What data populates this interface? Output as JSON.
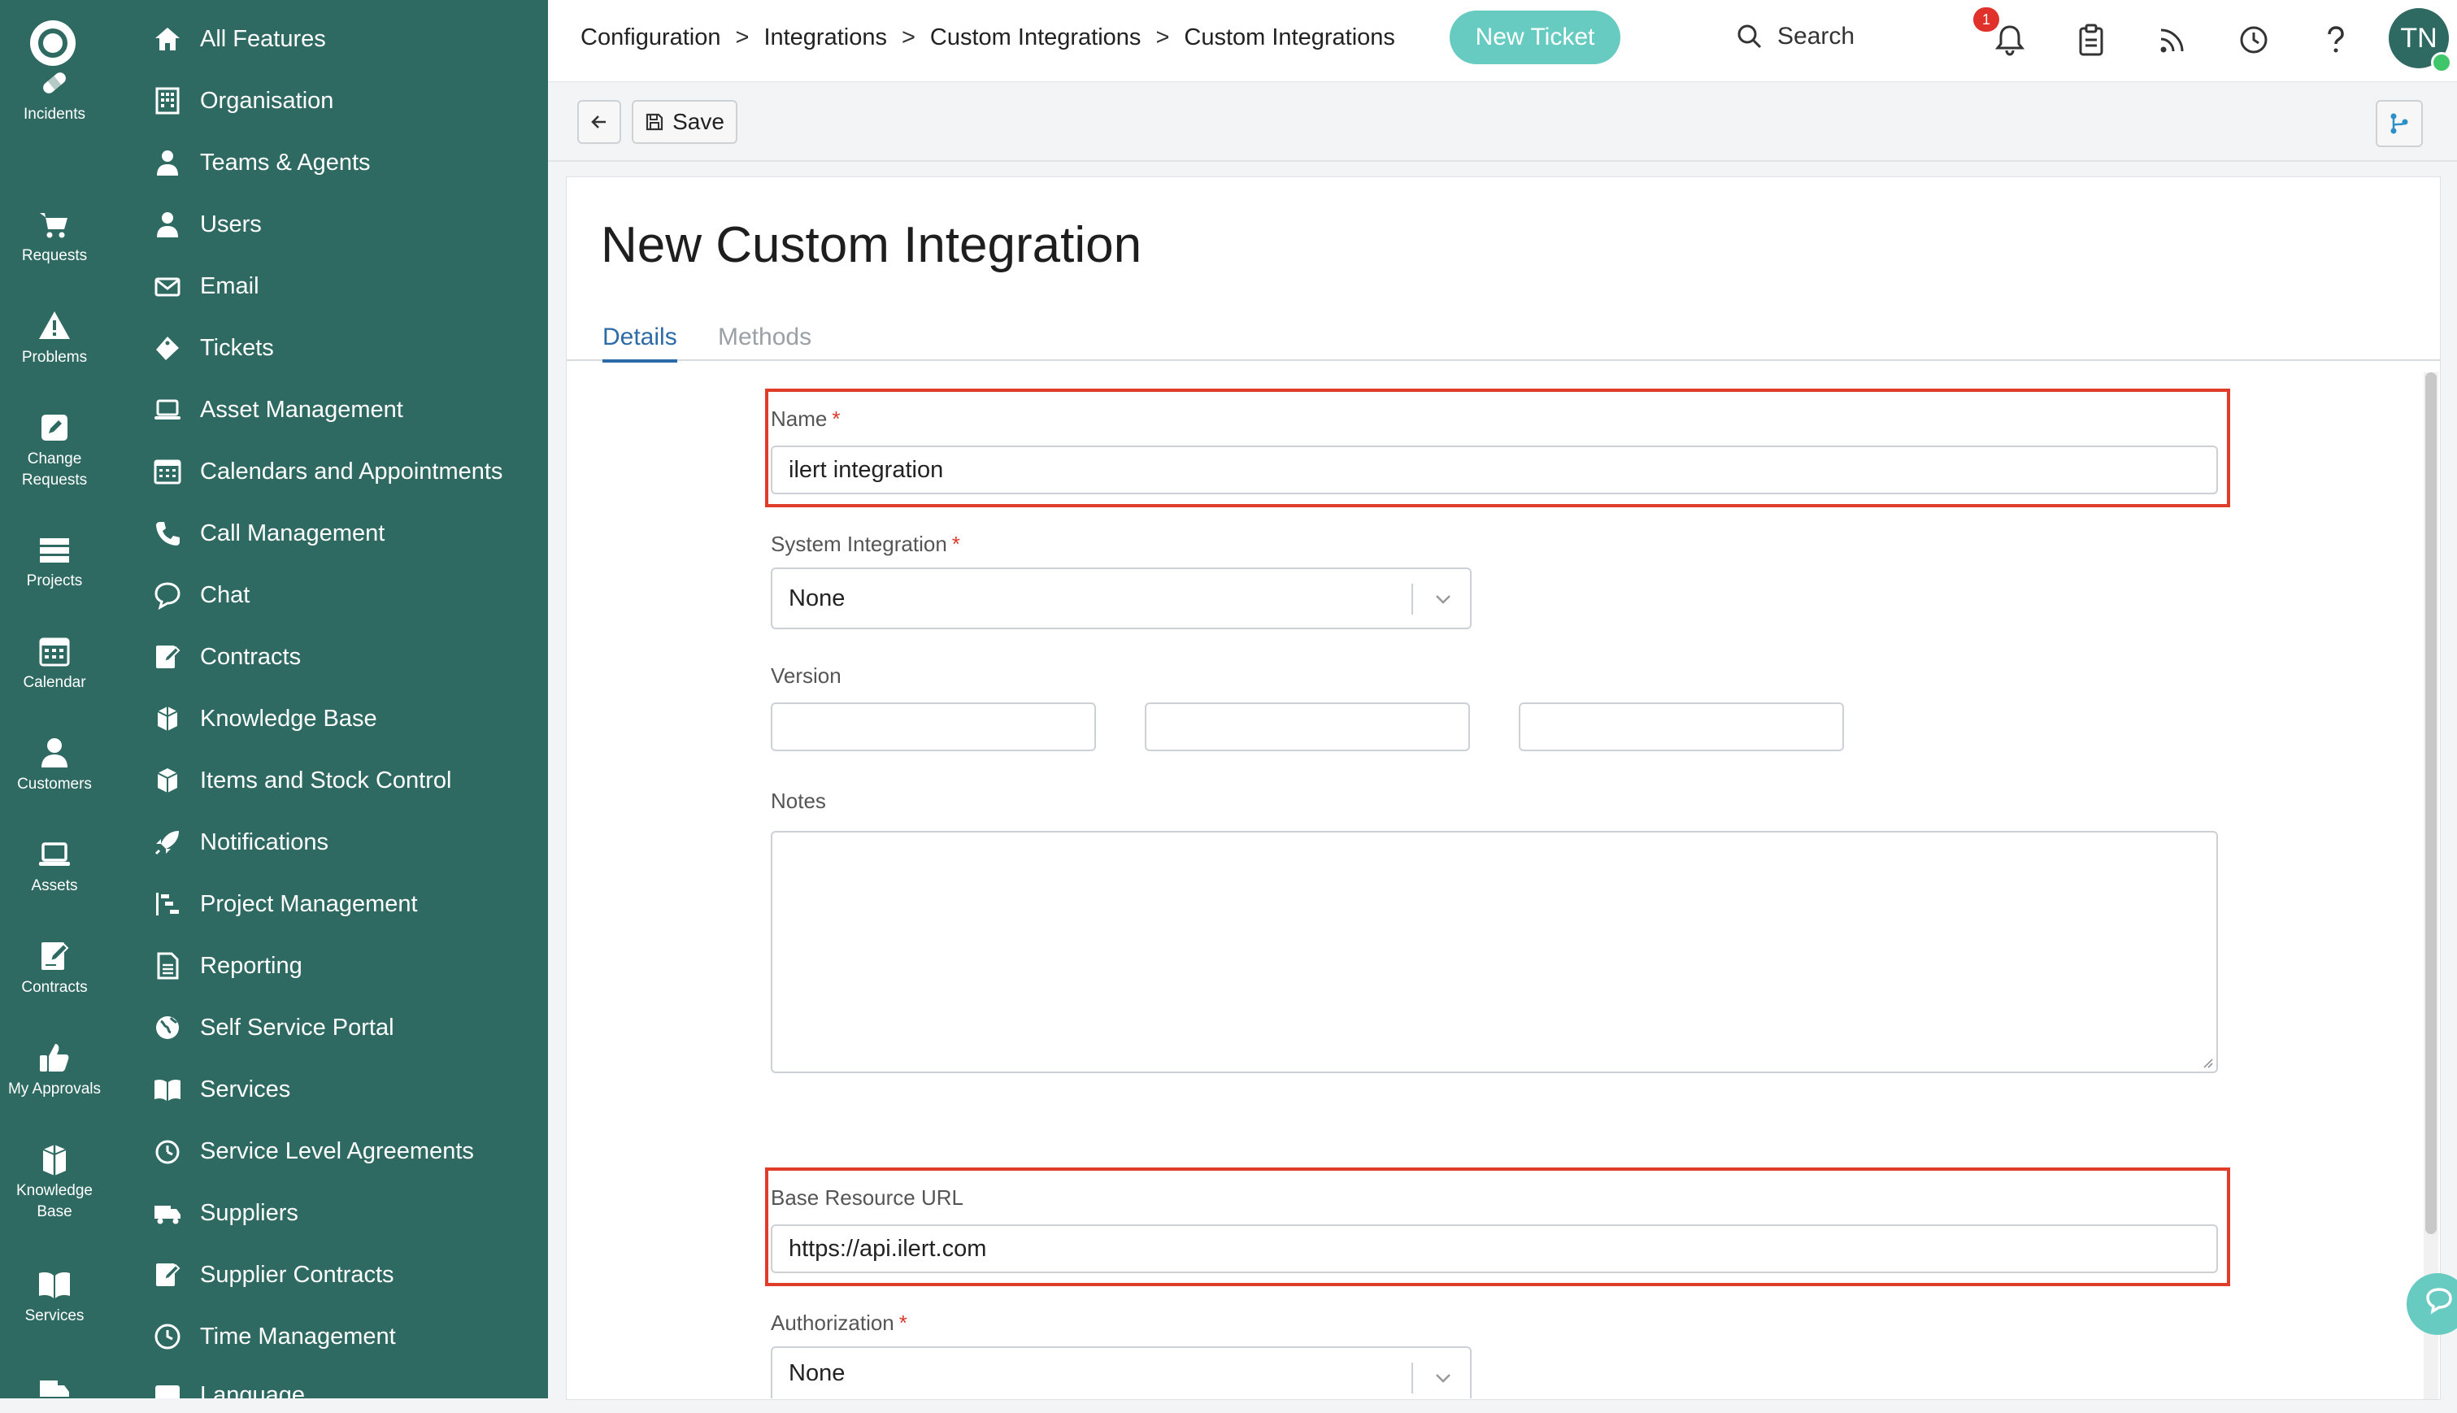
{
  "rail": {
    "items": [
      {
        "label": "Incidents",
        "icon": "bandage-icon"
      },
      {
        "label": "Requests",
        "icon": "cart-icon"
      },
      {
        "label": "Problems",
        "icon": "warning-icon"
      },
      {
        "label": "Change Requests",
        "line1": "Change",
        "line2": "Requests",
        "icon": "edit-icon"
      },
      {
        "label": "Projects",
        "icon": "projects-icon"
      },
      {
        "label": "Calendar",
        "icon": "calendar-icon"
      },
      {
        "label": "Customers",
        "icon": "person-icon"
      },
      {
        "label": "Assets",
        "icon": "laptop-icon"
      },
      {
        "label": "Contracts",
        "icon": "contract-icon"
      },
      {
        "label": "My Approvals",
        "icon": "thumbs-up-icon"
      },
      {
        "label": "Knowledge Base",
        "line1": "Knowledge",
        "line2": "Base",
        "icon": "books-icon"
      },
      {
        "label": "Services",
        "icon": "book-icon"
      }
    ]
  },
  "features": {
    "items": [
      {
        "label": "All Features",
        "icon": "home-icon"
      },
      {
        "label": "Organisation",
        "icon": "building-icon"
      },
      {
        "label": "Teams & Agents",
        "icon": "agent-icon"
      },
      {
        "label": "Users",
        "icon": "user-icon"
      },
      {
        "label": "Email",
        "icon": "email-icon"
      },
      {
        "label": "Tickets",
        "icon": "ticket-icon"
      },
      {
        "label": "Asset Management",
        "icon": "laptop-icon"
      },
      {
        "label": "Calendars and Appointments",
        "icon": "calendar-icon"
      },
      {
        "label": "Call Management",
        "icon": "phone-icon"
      },
      {
        "label": "Chat",
        "icon": "chat-icon"
      },
      {
        "label": "Contracts",
        "icon": "contract-icon"
      },
      {
        "label": "Knowledge Base",
        "icon": "box-icon"
      },
      {
        "label": "Items and Stock Control",
        "icon": "box-icon"
      },
      {
        "label": "Notifications",
        "icon": "rocket-icon"
      },
      {
        "label": "Project Management",
        "icon": "gantt-icon"
      },
      {
        "label": "Reporting",
        "icon": "document-icon"
      },
      {
        "label": "Self Service Portal",
        "icon": "globe-icon"
      },
      {
        "label": "Services",
        "icon": "book-icon"
      },
      {
        "label": "Service Level Agreements",
        "icon": "timer-icon"
      },
      {
        "label": "Suppliers",
        "icon": "truck-icon"
      },
      {
        "label": "Supplier Contracts",
        "icon": "contract-icon"
      },
      {
        "label": "Time Management",
        "icon": "clock-icon"
      },
      {
        "label": "Language",
        "icon": "language-icon"
      }
    ]
  },
  "header": {
    "breadcrumb": [
      "Configuration",
      "Integrations",
      "Custom Integrations",
      "Custom Integrations"
    ],
    "separator": ">",
    "new_ticket": "New Ticket",
    "search": "Search",
    "notification_count": "1",
    "avatar_initials": "TN"
  },
  "toolbar": {
    "save_label": "Save"
  },
  "page": {
    "title": "New Custom Integration",
    "tabs": [
      "Details",
      "Methods"
    ],
    "active_tab": "Details"
  },
  "form": {
    "name": {
      "label": "Name",
      "value": "ilert integration",
      "required": "*"
    },
    "system_integration": {
      "label": "System Integration",
      "value": "None",
      "required": "*"
    },
    "version": {
      "label": "Version",
      "values": [
        "",
        "",
        ""
      ]
    },
    "notes": {
      "label": "Notes",
      "value": ""
    },
    "base_url": {
      "label": "Base Resource URL",
      "value": "https://api.ilert.com"
    },
    "authorization": {
      "label": "Authorization",
      "value": "None",
      "required": "*"
    }
  },
  "colors": {
    "sidebar": "#2e6a62",
    "accent": "#68cbc1",
    "tab_active": "#2d6ba8",
    "highlight": "#e03c2a",
    "badge": "#e0322a"
  }
}
